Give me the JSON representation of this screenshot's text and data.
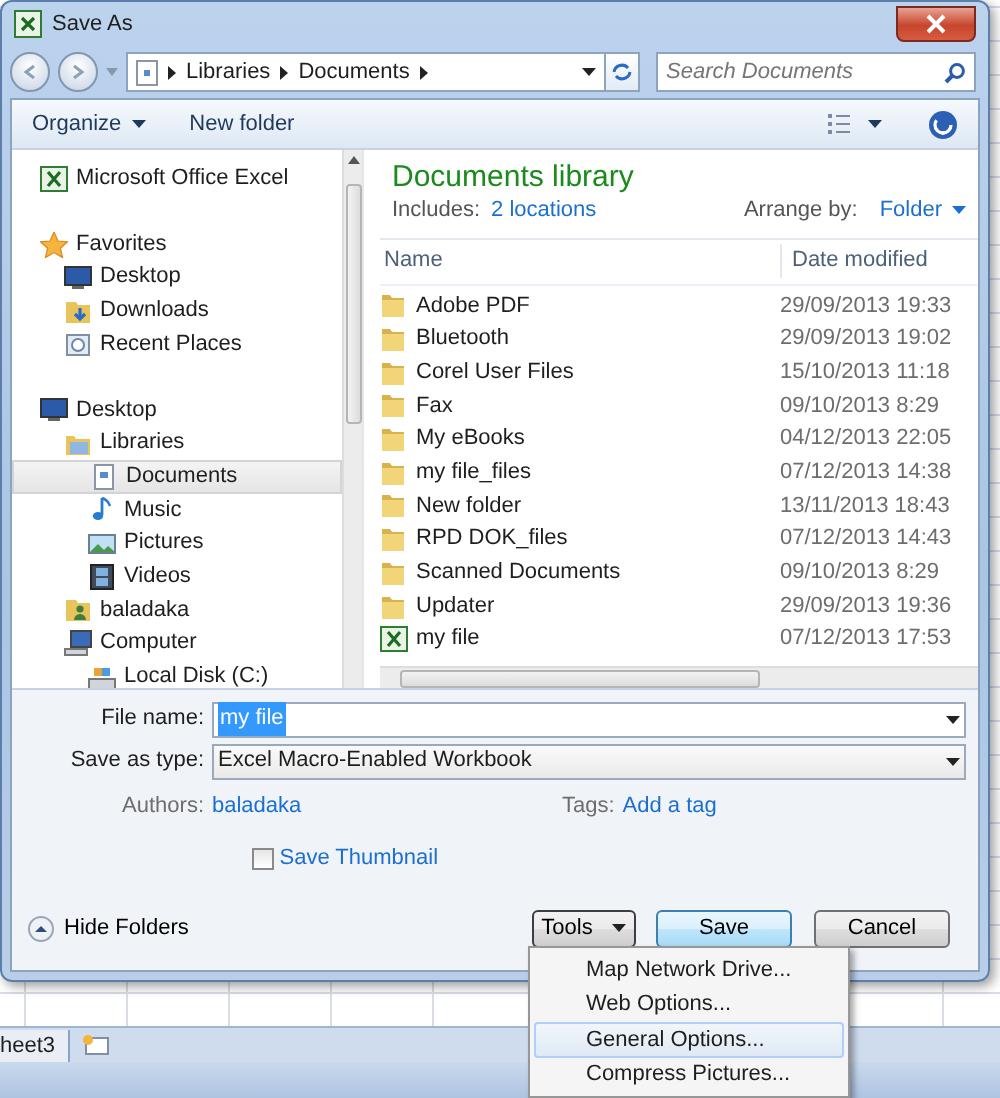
{
  "window": {
    "title": "Save As"
  },
  "address_bar": {
    "breadcrumbs": [
      "Libraries",
      "Documents"
    ]
  },
  "search": {
    "placeholder": "Search Documents"
  },
  "toolbar": {
    "organize": "Organize",
    "new_folder": "New folder"
  },
  "nav_pane": {
    "items": [
      {
        "label": "Microsoft Office Excel",
        "kind": "excel",
        "selected": false
      },
      {
        "label": "Favorites",
        "kind": "star",
        "selected": false,
        "children": [
          {
            "label": "Desktop",
            "kind": "desktop",
            "selected": false
          },
          {
            "label": "Downloads",
            "kind": "downloads",
            "selected": false
          },
          {
            "label": "Recent Places",
            "kind": "recent",
            "selected": false
          }
        ]
      },
      {
        "label": "Desktop",
        "kind": "desktop",
        "selected": false,
        "children": [
          {
            "label": "Libraries",
            "kind": "libraries",
            "selected": false,
            "children": [
              {
                "label": "Documents",
                "kind": "documents",
                "selected": true
              },
              {
                "label": "Music",
                "kind": "music",
                "selected": false
              },
              {
                "label": "Pictures",
                "kind": "pictures",
                "selected": false
              },
              {
                "label": "Videos",
                "kind": "videos",
                "selected": false
              }
            ]
          },
          {
            "label": "baladaka",
            "kind": "user",
            "selected": false
          },
          {
            "label": "Computer",
            "kind": "computer",
            "selected": false,
            "children": [
              {
                "label": "Local Disk (C:)",
                "kind": "disk",
                "selected": false
              }
            ]
          }
        ]
      }
    ]
  },
  "library": {
    "title": "Documents library",
    "includes_label": "Includes:",
    "includes_link": "2 locations",
    "arrange_label": "Arrange by:",
    "arrange_value": "Folder"
  },
  "columns": [
    "Name",
    "Date modified"
  ],
  "files": [
    {
      "name": "Adobe PDF",
      "date": "29/09/2013 19:33",
      "kind": "folder"
    },
    {
      "name": "Bluetooth",
      "date": "29/09/2013 19:02",
      "kind": "folder"
    },
    {
      "name": "Corel User Files",
      "date": "15/10/2013 11:18",
      "kind": "folder"
    },
    {
      "name": "Fax",
      "date": "09/10/2013 8:29",
      "kind": "folder"
    },
    {
      "name": "My eBooks",
      "date": "04/12/2013 22:05",
      "kind": "folder"
    },
    {
      "name": "my file_files",
      "date": "07/12/2013 14:38",
      "kind": "folder"
    },
    {
      "name": "New folder",
      "date": "13/11/2013 18:43",
      "kind": "folder"
    },
    {
      "name": "RPD DOK_files",
      "date": "07/12/2013 14:43",
      "kind": "folder"
    },
    {
      "name": "Scanned Documents",
      "date": "09/10/2013 8:29",
      "kind": "folder"
    },
    {
      "name": "Updater",
      "date": "29/09/2013 19:36",
      "kind": "folder"
    },
    {
      "name": "my file",
      "date": "07/12/2013 17:53",
      "kind": "excel"
    }
  ],
  "file_name": {
    "label": "File name:",
    "value": "my file",
    "text_selected": true
  },
  "save_as_type": {
    "label": "Save as type:",
    "value": "Excel Macro-Enabled Workbook"
  },
  "authors": {
    "label": "Authors:",
    "value": "baladaka"
  },
  "tags": {
    "label": "Tags:",
    "value": "Add a tag"
  },
  "save_thumbnail": {
    "label": "Save Thumbnail",
    "checked": false
  },
  "hide_folders": "Hide Folders",
  "buttons": {
    "tools": "Tools",
    "save": "Save",
    "cancel": "Cancel"
  },
  "tools_menu": [
    {
      "label": "Map Network Drive...",
      "selected": false
    },
    {
      "label": "Web Options...",
      "selected": false
    },
    {
      "label": "General Options...",
      "selected": true
    },
    {
      "label": "Compress Pictures...",
      "selected": false
    }
  ],
  "sheet_tab": "heet3"
}
